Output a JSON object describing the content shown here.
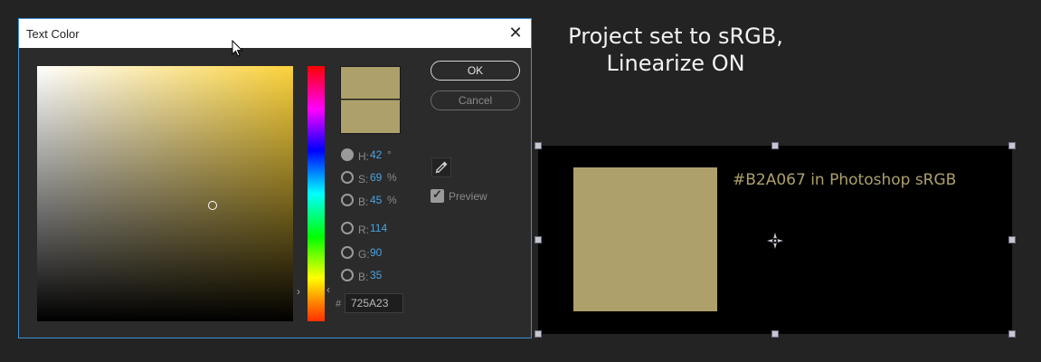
{
  "annotation": {
    "line1": "Project set to sRGB,",
    "line2": "Linearize ON"
  },
  "dialog": {
    "title": "Text Color",
    "close_glyph": "✕",
    "ok_label": "OK",
    "cancel_label": "Cancel",
    "preview_label": "Preview",
    "preview_checked": true,
    "selected_mode": "H",
    "hsb": [
      {
        "label": "H:",
        "value": "42",
        "unit": "°"
      },
      {
        "label": "S:",
        "value": "69",
        "unit": "%"
      },
      {
        "label": "B:",
        "value": "45",
        "unit": "%"
      }
    ],
    "rgb": [
      {
        "label": "R:",
        "value": "114"
      },
      {
        "label": "G:",
        "value": "90"
      },
      {
        "label": "B:",
        "value": "35"
      }
    ],
    "hex_symbol": "#",
    "hex_value": "725A23",
    "swatch_color": "#ada06b",
    "field_hue_color": "#fcd23a",
    "hue_arrow_left": "›",
    "hue_arrow_right": "‹"
  },
  "program_monitor": {
    "caption": "#B2A067 in Photoshop sRGB",
    "block_color": "#ada06b",
    "caption_color": "#ada06b",
    "background_color": "#000000"
  }
}
